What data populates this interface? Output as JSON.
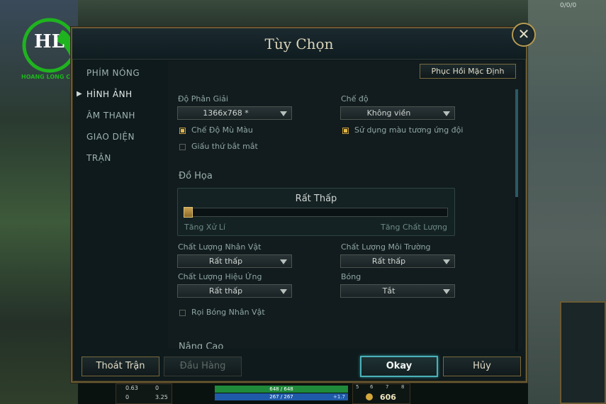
{
  "window": {
    "title": "Tùy Chọn",
    "close_symbol": "✕"
  },
  "sidebar": {
    "items": [
      {
        "label": "PHÍM NÓNG"
      },
      {
        "label": "HÌNH ẢNH"
      },
      {
        "label": "ÂM THANH"
      },
      {
        "label": "GIAO DIỆN"
      },
      {
        "label": "TRẬN"
      }
    ],
    "active_index": 1
  },
  "content": {
    "restore_defaults_label": "Phục Hồi Mặc Định",
    "resolution": {
      "label": "Độ Phân Giải",
      "value": "1366x768 *"
    },
    "mode": {
      "label": "Chế độ",
      "value": "Không viền"
    },
    "colorblind": {
      "label": "Chế Độ Mù Màu",
      "checked": true
    },
    "team_colors": {
      "label": "Sử dụng màu tương ứng đội",
      "checked": true
    },
    "hide_eye_candy": {
      "label": "Giấu thứ bắt mắt",
      "checked": false
    },
    "graphics": {
      "section_title": "Đồ Họa",
      "level": "Rất Thấp",
      "slider_value": 0,
      "left_hint": "Tăng Xử Lí",
      "right_hint": "Tăng Chất Lượng"
    },
    "character_quality": {
      "label": "Chất Lượng Nhân Vật",
      "value": "Rất thấp"
    },
    "environment_quality": {
      "label": "Chất Lượng Môi Trường",
      "value": "Rất thấp"
    },
    "effects_quality": {
      "label": "Chất Lượng Hiệu Ứng",
      "value": "Rất thấp"
    },
    "shadows": {
      "label": "Bóng",
      "value": "Tắt"
    },
    "character_inking": {
      "label": "Rọi Bóng Nhân Vật",
      "checked": false
    },
    "advanced_title": "Nâng Cao"
  },
  "footer": {
    "quit_label": "Thoát Trận",
    "surrender_label": "Đầu Hàng",
    "okay_label": "Okay",
    "cancel_label": "Hủy"
  },
  "hud": {
    "top_stat": "0/0/0",
    "stat_a": "0.63",
    "stat_b": "0",
    "stat_c": "0",
    "stat_d": "3.25",
    "health": "648 / 648",
    "mana": "267 / 267",
    "regen": "+1.7",
    "gold": "606",
    "level_marks": [
      "5",
      "6",
      "7",
      "8"
    ]
  },
  "logo": {
    "letters": "HL",
    "caption": "HOANG LONG COMPUTER"
  },
  "colors": {
    "accent_gold": "#b59a52",
    "accent_teal": "#4bb1b9",
    "window_bg": "#0f1a1c"
  }
}
